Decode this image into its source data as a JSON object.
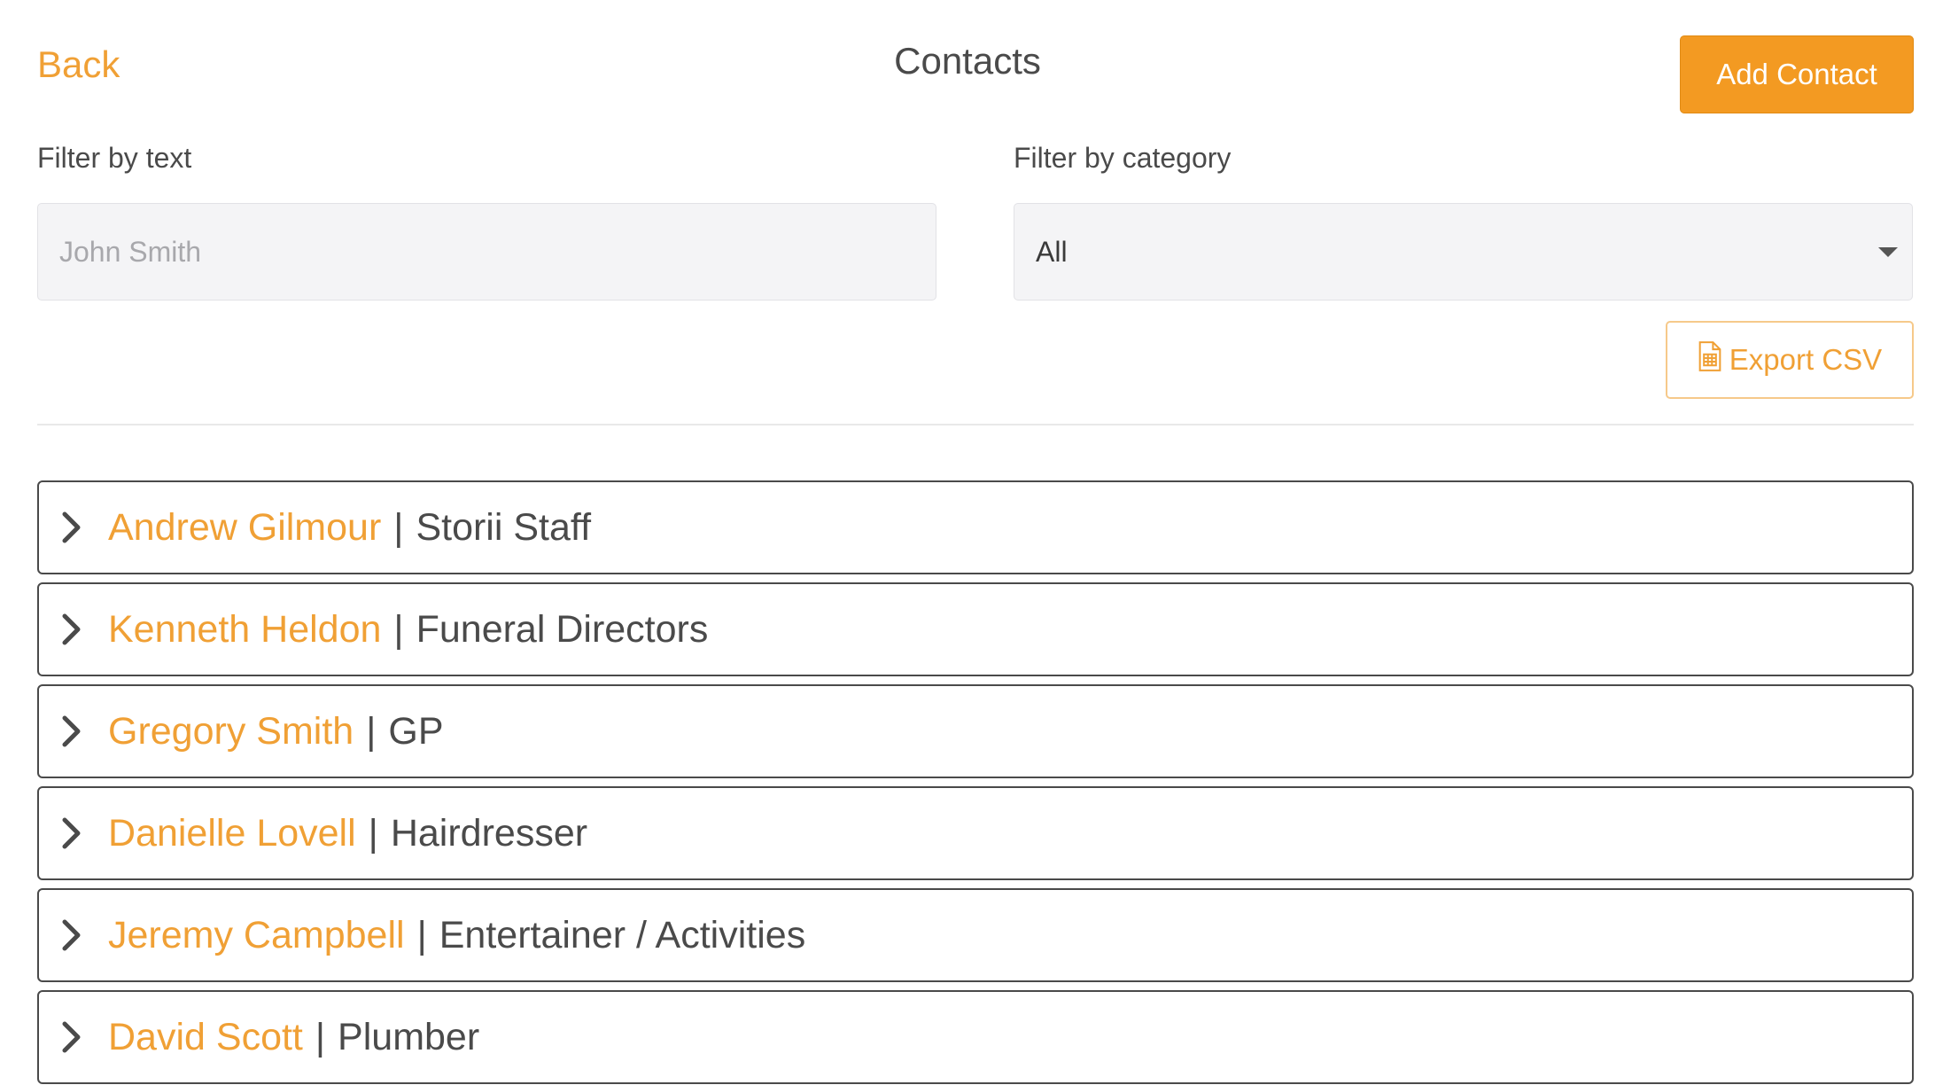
{
  "header": {
    "back_label": "Back",
    "title": "Contacts",
    "add_label": "Add Contact"
  },
  "filters": {
    "text_label": "Filter by text",
    "text_placeholder": "John Smith",
    "text_value": "",
    "category_label": "Filter by category",
    "category_value": "All"
  },
  "export": {
    "label": "Export CSV",
    "icon": "file-spreadsheet-icon"
  },
  "contacts": [
    {
      "name": "Andrew Gilmour",
      "separator": "|",
      "category": "Storii Staff"
    },
    {
      "name": "Kenneth Heldon",
      "separator": "|",
      "category": "Funeral Directors"
    },
    {
      "name": "Gregory Smith",
      "separator": "|",
      "category": "GP"
    },
    {
      "name": "Danielle Lovell",
      "separator": "|",
      "category": "Hairdresser"
    },
    {
      "name": "Jeremy Campbell",
      "separator": "|",
      "category": "Entertainer / Activities"
    },
    {
      "name": "David Scott",
      "separator": "|",
      "category": "Plumber"
    }
  ],
  "colors": {
    "accent": "#f39a22",
    "text": "#4a4a4a",
    "input_bg": "#f4f4f6"
  }
}
